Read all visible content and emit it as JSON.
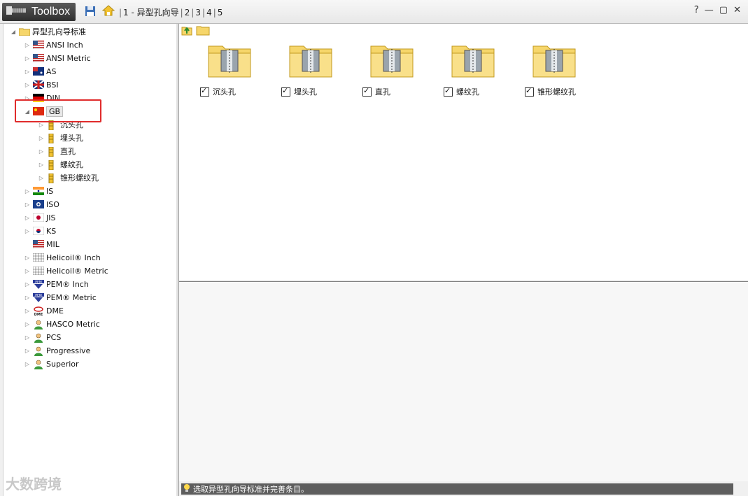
{
  "titlebar": {
    "app_name": "Toolbox",
    "crumbs": [
      "1 - 异型孔向导",
      "2",
      "3",
      "4",
      "5"
    ],
    "help": "?",
    "minimize": "—",
    "restore": "▢",
    "close": "✕"
  },
  "tree": {
    "root": "异型孔向导标准",
    "items": [
      {
        "label": "ANSI Inch",
        "flag": "us"
      },
      {
        "label": "ANSI Metric",
        "flag": "us"
      },
      {
        "label": "AS",
        "flag": "au"
      },
      {
        "label": "BSI",
        "flag": "uk"
      },
      {
        "label": "DIN",
        "flag": "de"
      },
      {
        "label": "GB",
        "flag": "cn"
      },
      {
        "label": "IS",
        "flag": "in"
      },
      {
        "label": "ISO",
        "flag": "iso"
      },
      {
        "label": "JIS",
        "flag": "jp"
      },
      {
        "label": "KS",
        "flag": "kr"
      },
      {
        "label": "MIL",
        "flag": "us"
      },
      {
        "label": "Helicoil® Inch",
        "flag": "grid"
      },
      {
        "label": "Helicoil® Metric",
        "flag": "grid"
      },
      {
        "label": "PEM® Inch",
        "flag": "pem"
      },
      {
        "label": "PEM® Metric",
        "flag": "pem"
      },
      {
        "label": "DME",
        "flag": "dme"
      },
      {
        "label": "HASCO Metric",
        "flag": "person"
      },
      {
        "label": "PCS",
        "flag": "person"
      },
      {
        "label": "Progressive",
        "flag": "person"
      },
      {
        "label": "Superior",
        "flag": "person"
      }
    ],
    "gb_children": [
      "沉头孔",
      "埋头孔",
      "直孔",
      "螺纹孔",
      "锥形螺纹孔"
    ]
  },
  "content": {
    "folders": [
      {
        "label": "沉头孔",
        "checked": true
      },
      {
        "label": "埋头孔",
        "checked": true
      },
      {
        "label": "直孔",
        "checked": true
      },
      {
        "label": "螺纹孔",
        "checked": true
      },
      {
        "label": "锥形螺纹孔",
        "checked": true
      }
    ]
  },
  "status": {
    "text": "选取异型孔向导标准并完善条目。"
  },
  "watermark": "大数跨境"
}
